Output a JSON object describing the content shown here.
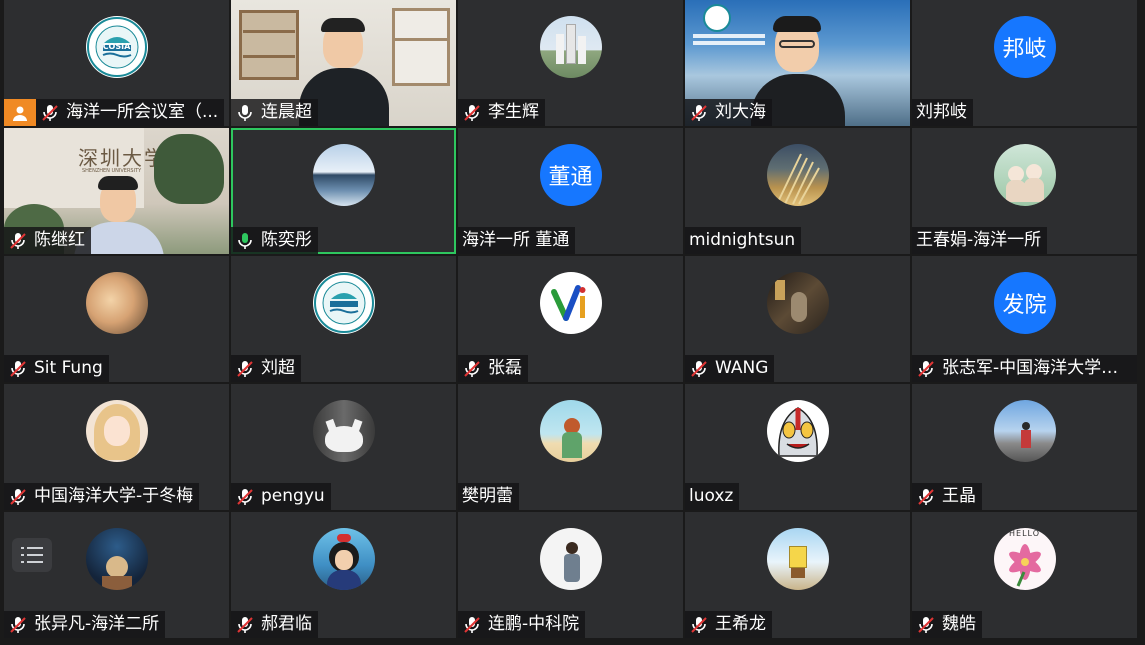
{
  "participants": [
    {
      "name": "海洋一所会议室（...",
      "mic": "muted",
      "kind": "avatar",
      "avatar": "cosia-logo",
      "host": true
    },
    {
      "name": "连晨超",
      "mic": "on",
      "kind": "video",
      "video": "bookshelf-room"
    },
    {
      "name": "李生辉",
      "mic": "muted",
      "kind": "avatar",
      "avatar": "tower-photo"
    },
    {
      "name": "刘大海",
      "mic": "muted",
      "kind": "video",
      "video": "sky-background"
    },
    {
      "name": "刘邦岐",
      "mic": "none",
      "kind": "text",
      "initials": "邦岐"
    },
    {
      "name": "陈继红",
      "mic": "muted",
      "kind": "video",
      "video": "shenzhen-university"
    },
    {
      "name": "陈奕彤",
      "mic": "speaking",
      "kind": "avatar",
      "avatar": "sea-photo",
      "active": true
    },
    {
      "name": "海洋一所 董通",
      "mic": "none",
      "kind": "text",
      "initials": "董通"
    },
    {
      "name": "midnightsun",
      "mic": "none",
      "kind": "avatar",
      "avatar": "reeds-photo"
    },
    {
      "name": "王春娟-海洋一所",
      "mic": "none",
      "kind": "avatar",
      "avatar": "cartoon-girls"
    },
    {
      "name": "Sit Fung",
      "mic": "muted",
      "kind": "avatar",
      "avatar": "dog-photo"
    },
    {
      "name": "刘超",
      "mic": "muted",
      "kind": "avatar",
      "avatar": "cosia-logo"
    },
    {
      "name": "张磊",
      "mic": "muted",
      "kind": "avatar",
      "avatar": "yi-letters"
    },
    {
      "name": "WANG",
      "mic": "muted",
      "kind": "avatar",
      "avatar": "dark-statue"
    },
    {
      "name": "张志军-中国海洋大学海发院",
      "mic": "muted",
      "kind": "text",
      "initials": "发院"
    },
    {
      "name": "中国海洋大学-于冬梅",
      "mic": "muted",
      "kind": "avatar",
      "avatar": "anime-girl"
    },
    {
      "name": "pengyu",
      "mic": "muted",
      "kind": "avatar",
      "avatar": "white-cat"
    },
    {
      "name": "樊明蕾",
      "mic": "none",
      "kind": "avatar",
      "avatar": "beach-girl"
    },
    {
      "name": "luoxz",
      "mic": "none",
      "kind": "avatar",
      "avatar": "ultraman"
    },
    {
      "name": "王晶",
      "mic": "muted",
      "kind": "avatar",
      "avatar": "road-person"
    },
    {
      "name": "张异凡-海洋二所",
      "mic": "muted",
      "kind": "avatar",
      "avatar": "cartoon-night"
    },
    {
      "name": "郝君临",
      "mic": "muted",
      "kind": "avatar",
      "avatar": "kiki-witch"
    },
    {
      "name": "连鹏-中科院",
      "mic": "muted",
      "kind": "avatar",
      "avatar": "person-photo"
    },
    {
      "name": "王希龙",
      "mic": "muted",
      "kind": "avatar",
      "avatar": "sponge-character"
    },
    {
      "name": "魏皓",
      "mic": "muted",
      "kind": "avatar",
      "avatar": "pink-lily"
    }
  ],
  "video_text": {
    "shenzhen_sign": "深圳大学",
    "shenzhen_sign_en": "SHENZHEN UNIVERSITY",
    "cosia": "COSIA",
    "lily_text": "HELLO"
  },
  "colors": {
    "tile_bg": "#2d2e30",
    "active_border": "#2ec75f",
    "text_avatar": "#1677ff",
    "host_badge": "#f08a24",
    "mic_muted": "#e03535"
  },
  "controls": {
    "chat_toggle_icon": "list-icon"
  }
}
